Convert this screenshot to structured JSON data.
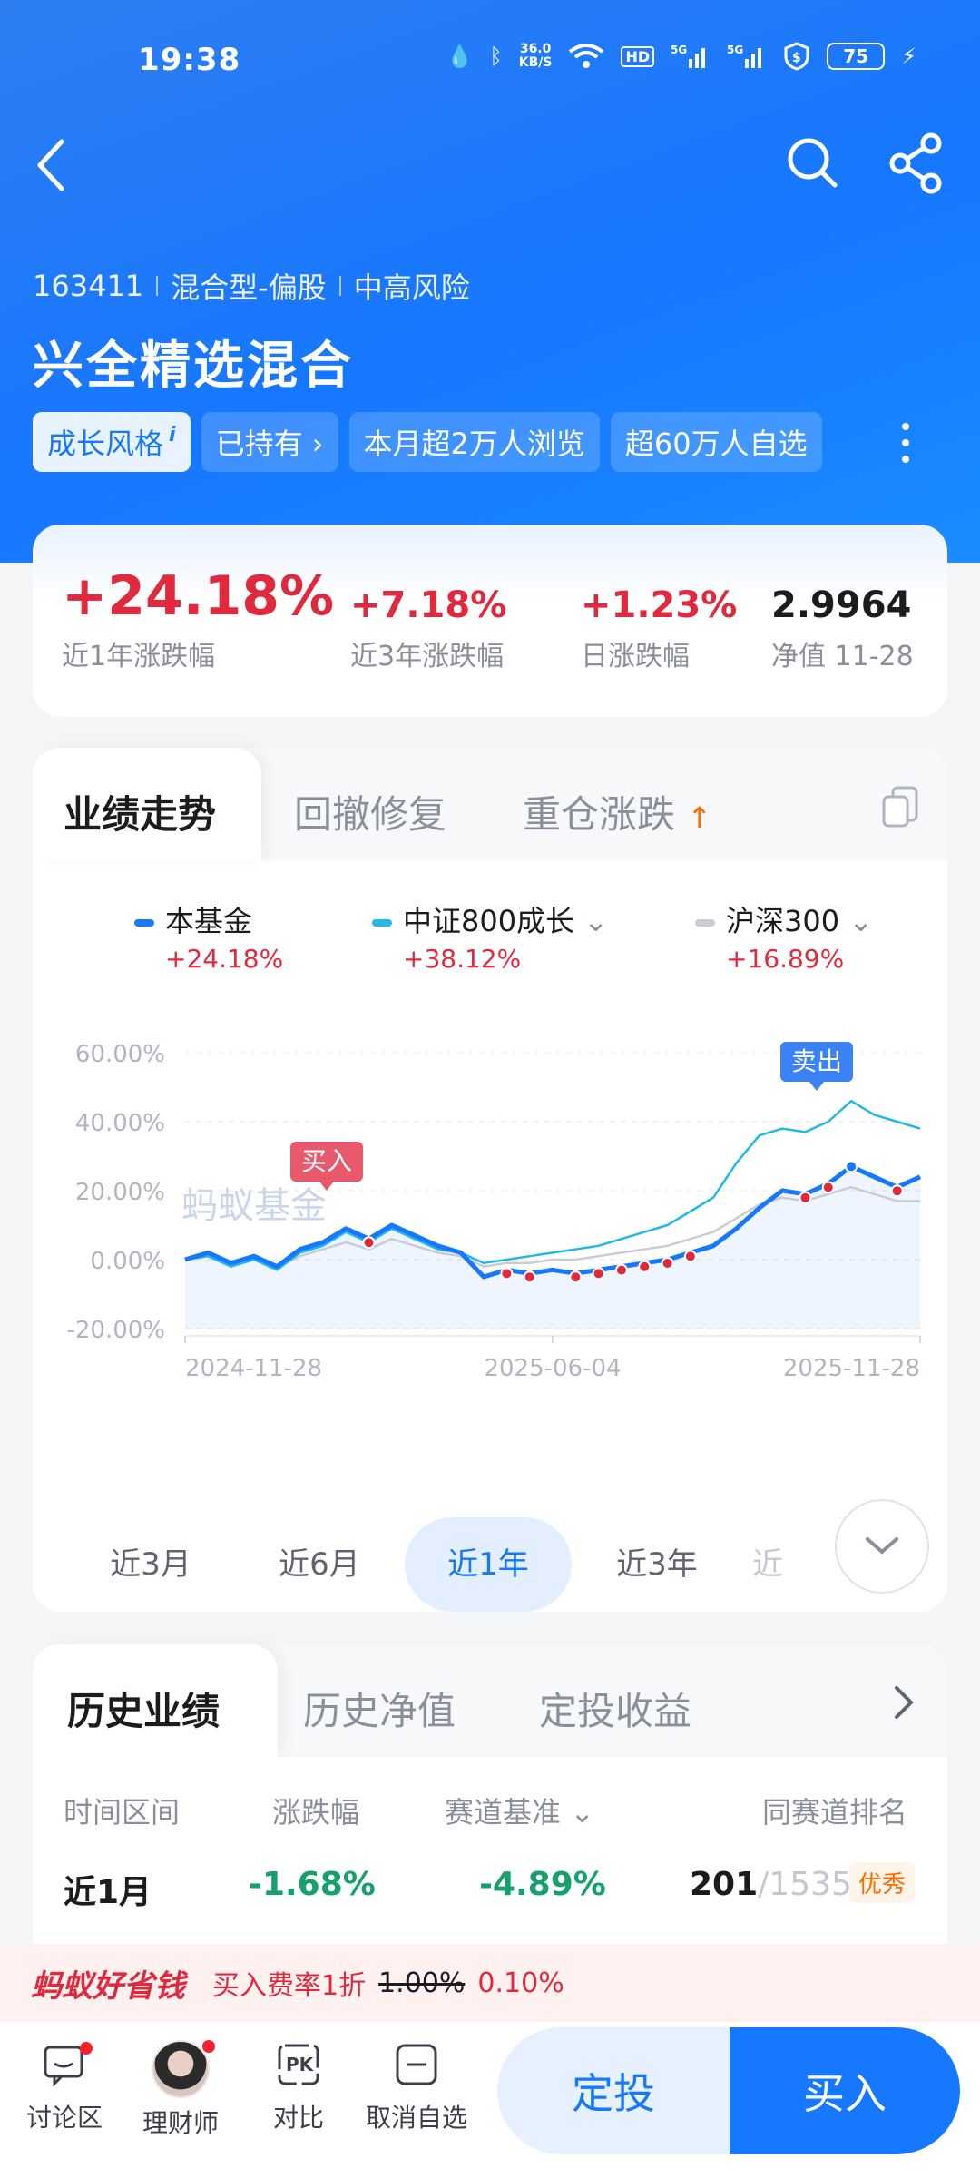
{
  "status_bar": {
    "time": "19:38",
    "net_speed_value": "36.0",
    "net_speed_unit": "KB/S",
    "battery": "75"
  },
  "fund": {
    "code": "163411",
    "category": "混合型-偏股",
    "risk": "中高风险",
    "name": "兴全精选混合",
    "tags": [
      "成长风格",
      "已持有 ›",
      "本月超2万人浏览",
      "超60万人自选"
    ]
  },
  "stats": [
    {
      "value": "+24.18%",
      "label": "近1年涨跌幅"
    },
    {
      "value": "+7.18%",
      "label": "近3年涨跌幅"
    },
    {
      "value": "+1.23%",
      "label": "日涨跌幅"
    },
    {
      "value": "2.9964",
      "label": "净值 11-28"
    }
  ],
  "chart_tabs": [
    "业绩走势",
    "回撤修复",
    "重仓涨跌"
  ],
  "legend": [
    {
      "name": "本基金",
      "pct": "+24.18%",
      "color": "#1677ff"
    },
    {
      "name": "中证800成长",
      "pct": "+38.12%",
      "color": "#22b8e6"
    },
    {
      "name": "沪深300",
      "pct": "+16.89%",
      "color": "#c9ccd2"
    }
  ],
  "chart_labels": {
    "buy": "买入",
    "sell": "卖出",
    "watermark": "蚂蚁基金"
  },
  "chart_data": {
    "type": "line",
    "ylim": [
      -20,
      60
    ],
    "y_ticks": [
      "60.00%",
      "40.00%",
      "20.00%",
      "0.00%",
      "-20.00%"
    ],
    "x_ticks": [
      "2024-11-28",
      "2025-06-04",
      "2025-11-28"
    ],
    "series": [
      {
        "name": "本基金",
        "values": [
          0,
          2,
          -1,
          1,
          -2,
          3,
          5,
          9,
          6,
          10,
          7,
          4,
          2,
          -5,
          -3,
          -4,
          -3,
          -4,
          -3,
          -2,
          -1,
          0,
          2,
          4,
          9,
          15,
          20,
          19,
          22,
          27,
          24,
          21,
          24
        ]
      },
      {
        "name": "中证800成长",
        "values": [
          0,
          1,
          -2,
          0,
          -3,
          2,
          4,
          8,
          5,
          9,
          6,
          3,
          2,
          -1,
          0,
          1,
          2,
          3,
          4,
          6,
          8,
          10,
          14,
          18,
          28,
          36,
          38,
          37,
          40,
          46,
          42,
          40,
          38
        ]
      },
      {
        "name": "沪深300",
        "values": [
          0,
          1,
          -1,
          0,
          -2,
          1,
          3,
          5,
          3,
          6,
          4,
          2,
          1,
          -2,
          -1,
          -1,
          0,
          0,
          1,
          2,
          3,
          4,
          6,
          8,
          12,
          16,
          18,
          17,
          19,
          21,
          19,
          17,
          17
        ]
      }
    ]
  },
  "periods": [
    "近3月",
    "近6月",
    "近1年",
    "近3年",
    "近"
  ],
  "history": {
    "tabs": [
      "历史业绩",
      "历史净值",
      "定投收益"
    ],
    "headers": [
      "时间区间",
      "涨跌幅",
      "赛道基准",
      "同赛道排名"
    ],
    "row": {
      "period": "近1月",
      "change": "-1.68%",
      "benchmark": "-4.89%",
      "rank": "201",
      "rank_total": "/1535",
      "badge": "优秀"
    }
  },
  "promo": {
    "title": "蚂蚁好省钱",
    "text": "买入费率1折",
    "old_rate": "1.00%",
    "new_rate": "0.10%"
  },
  "footer": {
    "items": [
      "讨论区",
      "理财师",
      "对比",
      "取消自选"
    ],
    "dingtou": "定投",
    "buy": "买入"
  }
}
